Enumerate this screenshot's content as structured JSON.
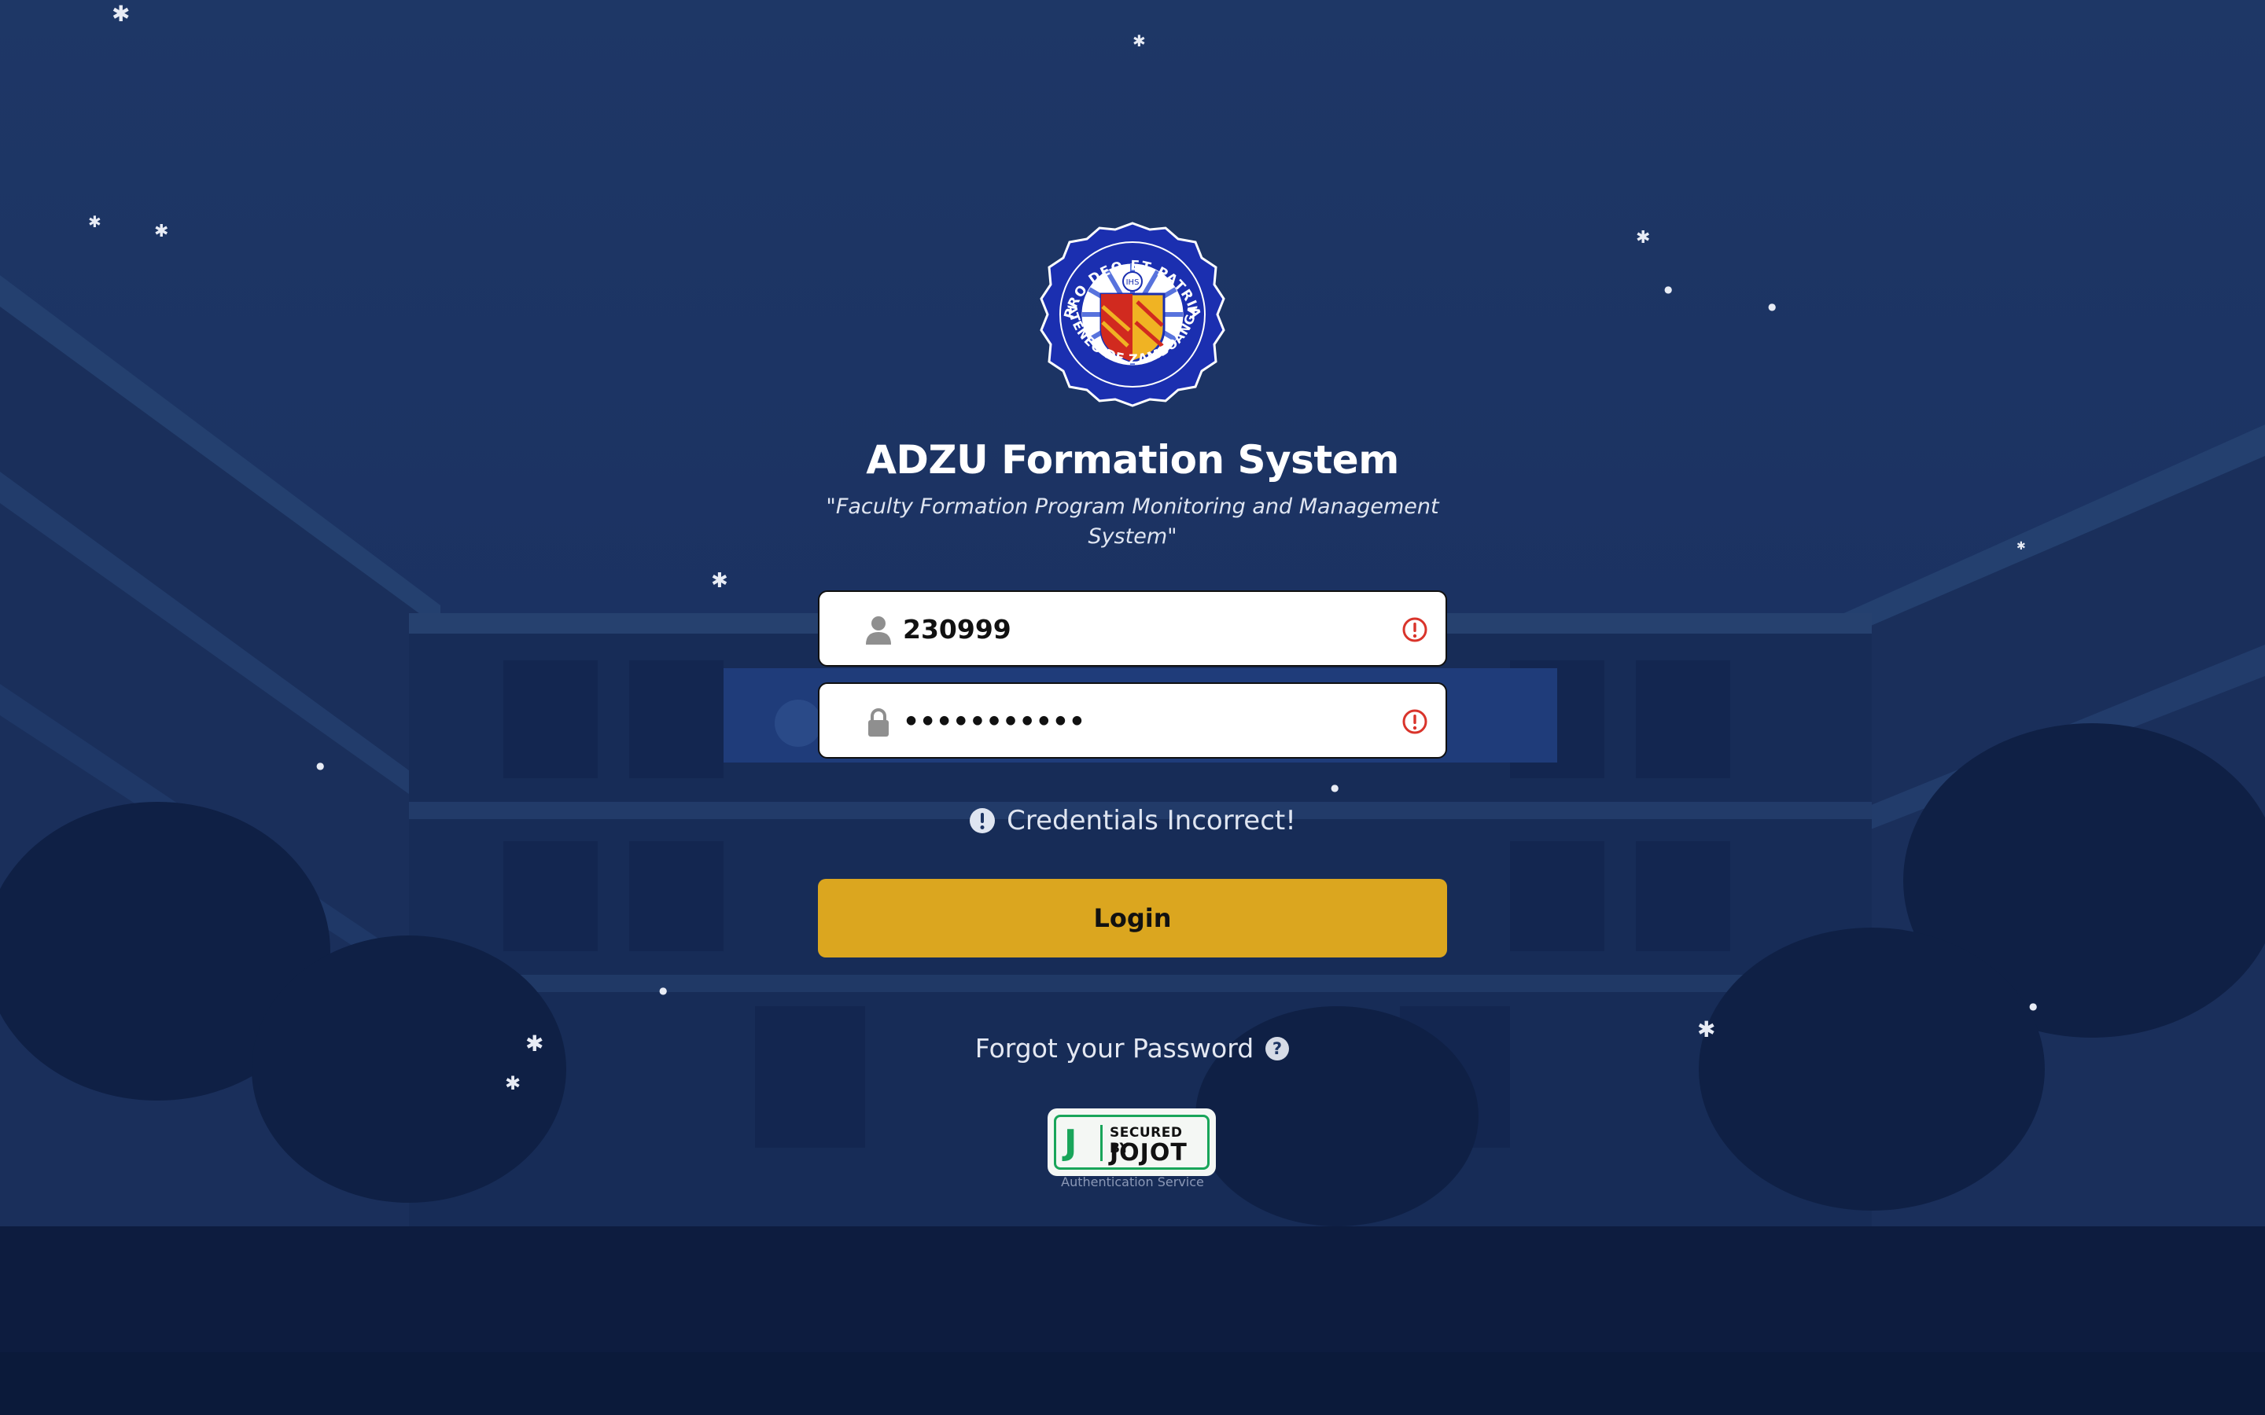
{
  "app": {
    "title": "ADZU Formation System",
    "subtitle": "\"Faculty Formation Program Monitoring and Management System\""
  },
  "seal": {
    "motto": "PRO DEO ET PATRIA",
    "name": "ATENEO DE ZAMBOANGA",
    "colors": {
      "ring": "#1b2fb0",
      "inner": "#2a45c9",
      "shield_red": "#d12a1f",
      "shield_gold": "#f0b323"
    }
  },
  "form": {
    "username": {
      "value": "230999",
      "icon": "user-icon",
      "status_icon": "error-icon"
    },
    "password": {
      "value": "•••••••••••",
      "icon": "lock-icon",
      "status_icon": "error-icon"
    },
    "error_message": "Credentials Incorrect!",
    "login_label": "Login",
    "forgot_label": "Forgot your Password"
  },
  "badge": {
    "letter": "J",
    "line1": "SECURED BY",
    "line2": "JOJOT",
    "caption": "Authentication Service"
  },
  "colors": {
    "background": "#1d3463",
    "accent": "#dba61f",
    "error": "#d9342b",
    "badge_green": "#19a55a"
  }
}
